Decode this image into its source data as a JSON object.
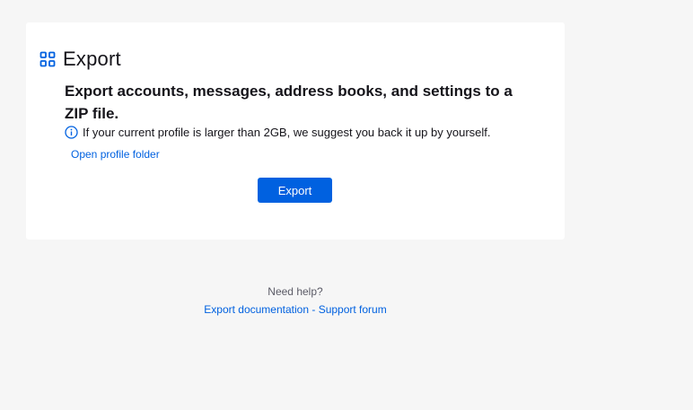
{
  "header": {
    "title": "Export",
    "icon": "grid-icon",
    "icon_color": "#0061e0"
  },
  "main": {
    "subtitle": "Export accounts, messages, address books, and settings to a ZIP file.",
    "note": "If your current profile is larger than 2GB, we suggest you back it up by yourself.",
    "note_icon": "info-icon",
    "open_profile_label": "Open profile folder",
    "export_button_label": "Export"
  },
  "help": {
    "need_help": "Need help?",
    "doc_link": "Export documentation",
    "separator": " - ",
    "forum_link": "Support forum"
  },
  "colors": {
    "accent": "#0061e0",
    "background": "#f6f6f6",
    "card": "#ffffff"
  }
}
